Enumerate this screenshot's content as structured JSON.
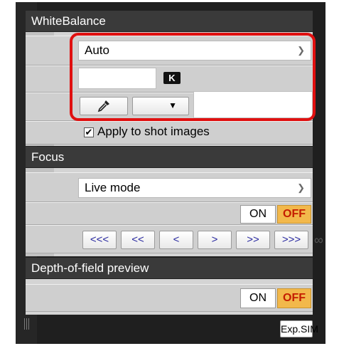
{
  "white_balance": {
    "title": "WhiteBalance",
    "mode_value": "Auto",
    "kelvin_value": "",
    "kelvin_unit": "K",
    "eyedropper_icon": "eyedropper-icon",
    "preset_dropdown_value": "",
    "apply_checked": true,
    "apply_label": "Apply to shot images"
  },
  "focus": {
    "title": "Focus",
    "mode_value": "Live mode",
    "on_label": "ON",
    "off_label": "OFF",
    "nav": [
      "<<<",
      "<<",
      "<",
      ">",
      ">>",
      ">>>"
    ],
    "infinity": "∞"
  },
  "dof": {
    "title": "Depth-of-field preview",
    "on_label": "ON",
    "off_label": "OFF"
  },
  "exp_sim_label": "Exp.SIM",
  "colors": {
    "highlight": "#e01010",
    "off_active": "#f2b84b"
  }
}
